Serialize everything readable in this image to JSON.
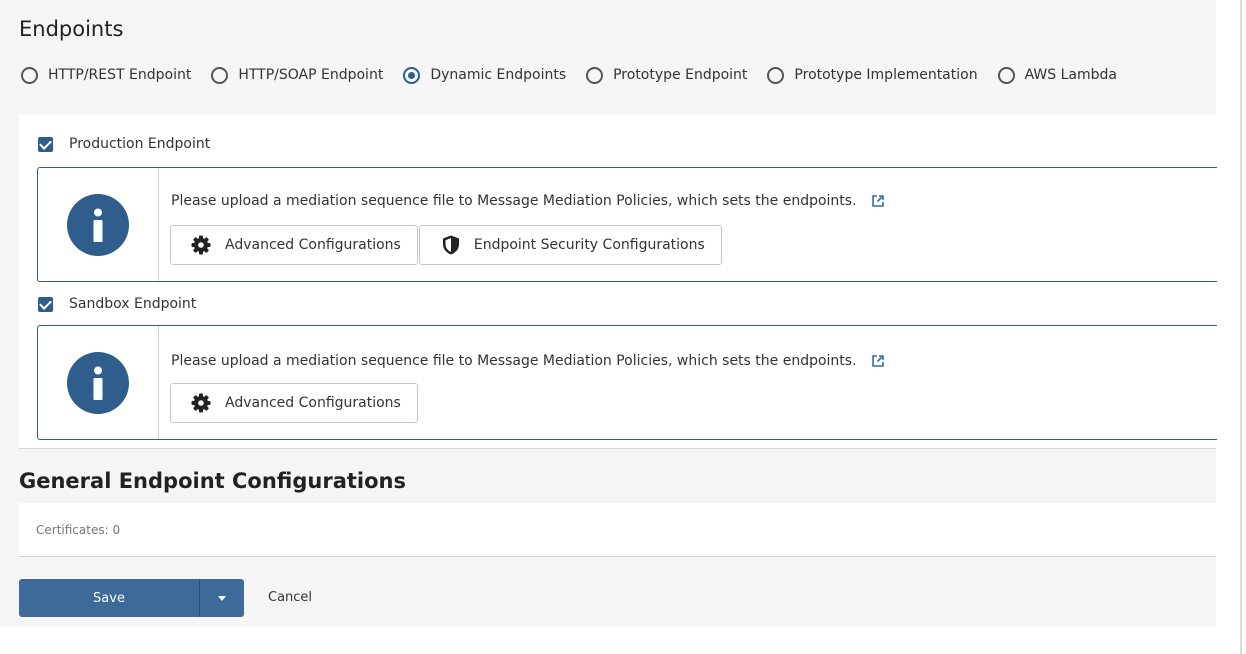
{
  "endpoints": {
    "title": "Endpoints",
    "types": [
      {
        "label": "HTTP/REST Endpoint",
        "checked": false
      },
      {
        "label": "HTTP/SOAP Endpoint",
        "checked": false
      },
      {
        "label": "Dynamic Endpoints",
        "checked": true
      },
      {
        "label": "Prototype Endpoint",
        "checked": false
      },
      {
        "label": "Prototype Implementation",
        "checked": false
      },
      {
        "label": "AWS Lambda",
        "checked": false
      }
    ]
  },
  "production": {
    "label": "Production Endpoint",
    "checked": true,
    "message": "Please upload a mediation sequence file to Message Mediation Policies, which sets the endpoints.",
    "advanced_label": "Advanced Configurations",
    "security_label": "Endpoint Security Configurations"
  },
  "sandbox": {
    "label": "Sandbox Endpoint",
    "checked": true,
    "message": "Please upload a mediation sequence file to Message Mediation Policies, which sets the endpoints.",
    "advanced_label": "Advanced Configurations"
  },
  "general": {
    "title": "General Endpoint Configurations",
    "certificates": "Certificates: 0"
  },
  "actions": {
    "save_label": "Save",
    "cancel_label": "Cancel"
  },
  "icons": {
    "info": "info-icon",
    "gear": "gear-icon",
    "shield": "shield-icon",
    "external_link": "external-link-icon",
    "caret": "caret-down-icon"
  },
  "colors": {
    "primary": "#2f5d8c",
    "button": "#3d6a99",
    "background": "#f5f5f5"
  }
}
